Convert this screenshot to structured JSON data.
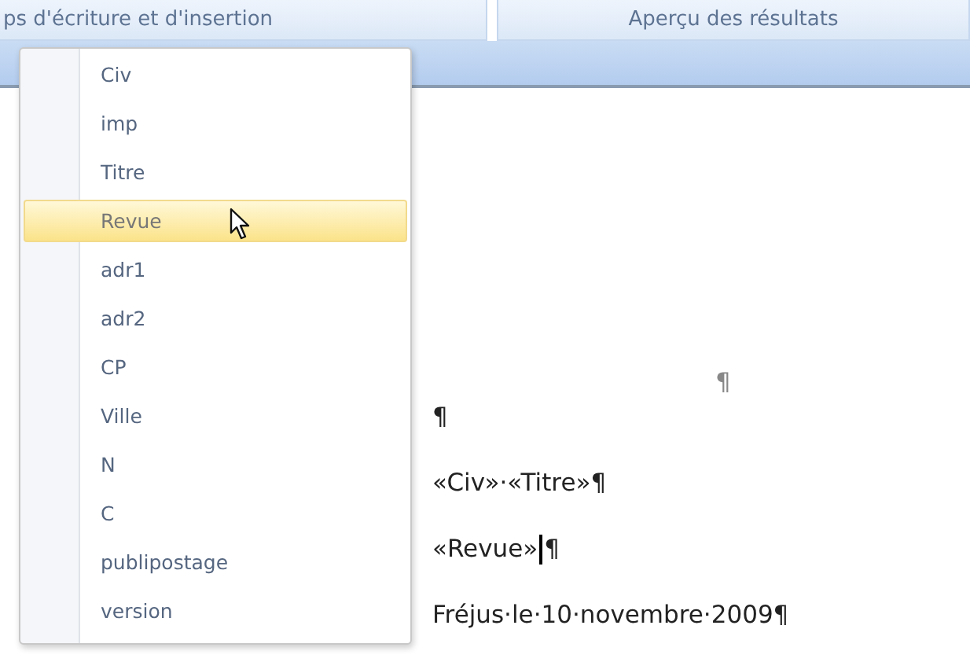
{
  "ribbon": {
    "groups": [
      {
        "label": "ps d'écriture et d'insertion"
      },
      {
        "label": "Aperçu des résultats"
      }
    ]
  },
  "document": {
    "lines": [
      {
        "kind": "end-mark",
        "text": "¶"
      },
      {
        "kind": "text",
        "text": "¶"
      },
      {
        "kind": "text",
        "text": "«Civ»·«Titre»¶"
      },
      {
        "kind": "cursor",
        "text": "«Revue»",
        "after": "¶"
      },
      {
        "kind": "text",
        "text": "Fréjus·le·10·novembre·2009¶"
      }
    ]
  },
  "menu": {
    "items": [
      {
        "label": "Civ",
        "selected": false
      },
      {
        "label": "imp",
        "selected": false
      },
      {
        "label": "Titre",
        "selected": false
      },
      {
        "label": "Revue",
        "selected": true
      },
      {
        "label": "adr1",
        "selected": false
      },
      {
        "label": "adr2",
        "selected": false
      },
      {
        "label": "CP",
        "selected": false
      },
      {
        "label": "Ville",
        "selected": false
      },
      {
        "label": "N",
        "selected": false
      },
      {
        "label": "C",
        "selected": false
      },
      {
        "label": "publipostage",
        "selected": false
      },
      {
        "label": "version",
        "selected": false
      }
    ]
  }
}
